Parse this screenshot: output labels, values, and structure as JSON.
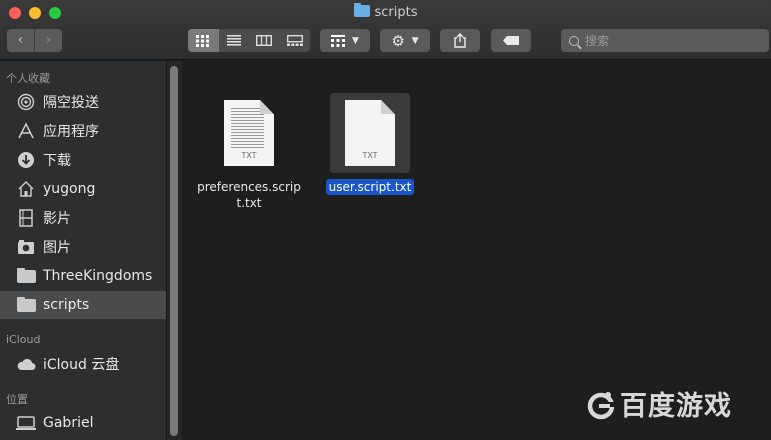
{
  "window": {
    "title": "scripts"
  },
  "toolbar": {
    "back_glyph": "‹",
    "forward_glyph": "›",
    "view_icons": [
      "icon-view-icon",
      "list-view-icon",
      "column-view-icon",
      "gallery-view-icon"
    ],
    "search_placeholder": "搜索"
  },
  "sidebar": {
    "favorites_header": "个人收藏",
    "favorites": [
      {
        "label": "隔空投送",
        "icon": "airdrop-icon"
      },
      {
        "label": "应用程序",
        "icon": "applications-icon"
      },
      {
        "label": "下载",
        "icon": "downloads-icon"
      },
      {
        "label": "yugong",
        "icon": "home-icon"
      },
      {
        "label": "影片",
        "icon": "movies-icon"
      },
      {
        "label": "图片",
        "icon": "pictures-icon"
      },
      {
        "label": "ThreeKingdoms",
        "icon": "folder-icon"
      },
      {
        "label": "scripts",
        "icon": "folder-icon",
        "selected": true
      }
    ],
    "icloud_header": "iCloud",
    "icloud": [
      {
        "label": "iCloud 云盘",
        "icon": "cloud-icon"
      }
    ],
    "locations_header": "位置",
    "locations": [
      {
        "label": "Gabriel",
        "icon": "computer-icon"
      }
    ]
  },
  "files": [
    {
      "name": "preferences.script.txt",
      "name_line1": "preferences.scrip",
      "name_line2": "t.txt",
      "ext": "TXT",
      "selected": false
    },
    {
      "name": "user.script.txt",
      "ext": "TXT",
      "selected": true
    }
  ],
  "watermark": "百度游戏",
  "colors": {
    "selection": "#1a56c7",
    "sidebar_bg": "#2d2e30",
    "content_bg": "#1e1e1e"
  }
}
